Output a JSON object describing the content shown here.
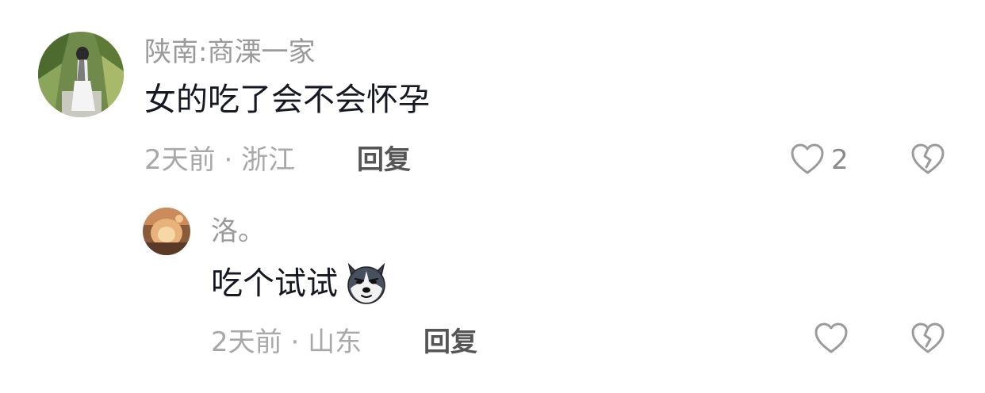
{
  "comments": [
    {
      "username": "陕南:商溧一家",
      "content": "女的吃了会不会怀孕",
      "time": "2天前",
      "location": "浙江",
      "meta_separator": " · ",
      "reply_label": "回复",
      "like_count": "2",
      "like_icon": "heart-outline-icon",
      "dislike_icon": "broken-heart-icon"
    },
    {
      "username": "洛。",
      "content": "吃个试试",
      "content_emoji": "husky-dog-emoji",
      "time": "2天前",
      "location": "山东",
      "meta_separator": " · ",
      "reply_label": "回复",
      "like_count": "",
      "like_icon": "heart-outline-icon",
      "dislike_icon": "broken-heart-icon"
    }
  ]
}
